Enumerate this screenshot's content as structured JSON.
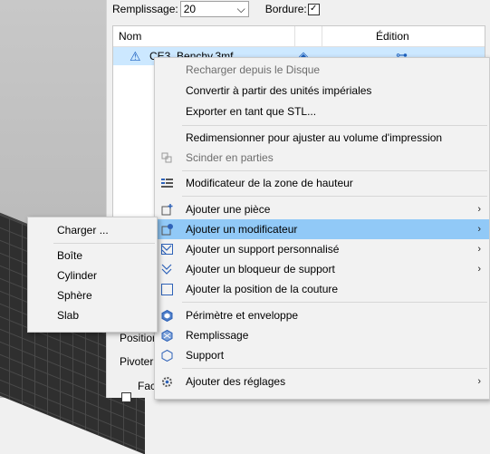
{
  "toolbar": {
    "infill_label": "Remplissage:",
    "infill_value": "20",
    "brim_label": "Bordure:",
    "brim_checked": "✓"
  },
  "object_list": {
    "col_name": "Nom",
    "col_edit": "Édition",
    "row_name": "CE3_Benchy.3mf"
  },
  "bottom_labels": {
    "position": "Position",
    "rotate": "Pivoter",
    "face": "Fac"
  },
  "context_menu": {
    "items": [
      {
        "label": "Recharger depuis le Disque",
        "disabled": true,
        "icon": "none"
      },
      {
        "label": "Convertir à partir des unités impériales",
        "disabled": false,
        "icon": "none"
      },
      {
        "label": "Exporter en tant que STL...",
        "disabled": false,
        "icon": "none"
      },
      {
        "label": "Redimensionner pour ajuster au volume d'impression",
        "disabled": false,
        "icon": "none"
      },
      {
        "label": "Scinder en parties",
        "disabled": true,
        "icon": "split-parts-icon"
      },
      {
        "label": "Modificateur de la zone de hauteur",
        "disabled": false,
        "icon": "height-range-icon"
      },
      {
        "label": "Ajouter une pièce",
        "disabled": false,
        "icon": "add-part-icon",
        "submenu": true
      },
      {
        "label": "Ajouter un modificateur",
        "disabled": false,
        "icon": "add-modifier-icon",
        "submenu": true,
        "highlighted": true
      },
      {
        "label": "Ajouter un support personnalisé",
        "disabled": false,
        "icon": "support-enforcer-icon",
        "submenu": true
      },
      {
        "label": "Ajouter un bloqueur de support",
        "disabled": false,
        "icon": "support-blocker-icon",
        "submenu": true
      },
      {
        "label": "Ajouter la position de la couture",
        "disabled": false,
        "icon": "seam-position-icon"
      },
      {
        "label": "Périmètre et enveloppe",
        "disabled": false,
        "icon": "perimeter-icon"
      },
      {
        "label": "Remplissage",
        "disabled": false,
        "icon": "infill-icon"
      },
      {
        "label": "Support",
        "disabled": false,
        "icon": "support-icon"
      },
      {
        "label": "Ajouter des réglages",
        "disabled": false,
        "icon": "gear-icon",
        "submenu": true
      }
    ]
  },
  "submenu": {
    "load": "Charger ...",
    "items": [
      "Boîte",
      "Cylinder",
      "Sphère",
      "Slab"
    ]
  },
  "glyphs": {
    "dropdown": "⌵",
    "submenu_arrow": "›",
    "warning": "⚠",
    "eye": "◈",
    "edit": "⊶"
  },
  "colors": {
    "highlight": "#91c9f7",
    "selection": "#cce8ff",
    "icon_blue": "#2e62b8"
  }
}
